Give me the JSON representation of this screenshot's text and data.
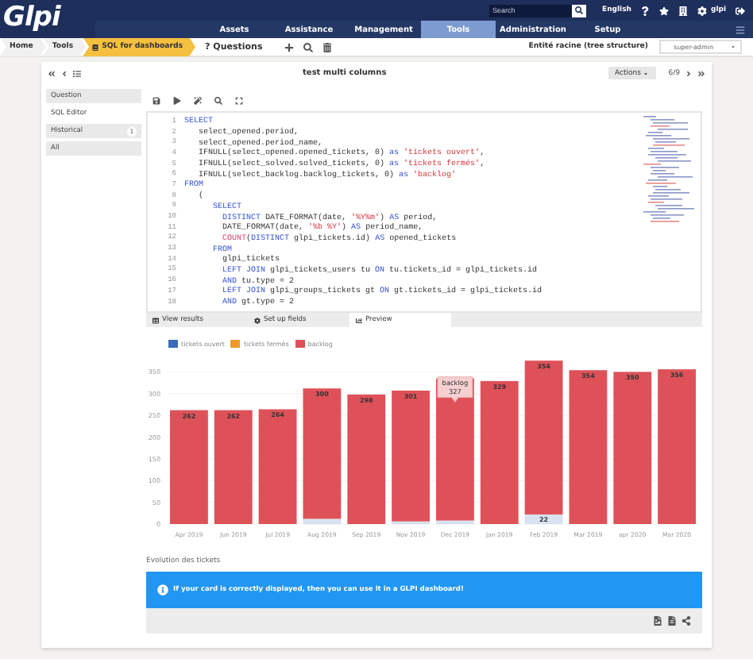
{
  "header": {
    "logo": "Glpi",
    "search": {
      "placeholder": "Search"
    },
    "language": "English",
    "user": "glpi"
  },
  "menu": [
    {
      "label": "Assets",
      "selected": false
    },
    {
      "label": "Assistance",
      "selected": false
    },
    {
      "label": "Management",
      "selected": false
    },
    {
      "label": "Tools",
      "selected": true
    },
    {
      "label": "Administration",
      "selected": false
    },
    {
      "label": "Setup",
      "selected": false
    }
  ],
  "breadcrumb": [
    {
      "label": "Home",
      "kind": "crumb"
    },
    {
      "label": "Tools",
      "kind": "crumb"
    },
    {
      "label": "SQL for dashboards",
      "kind": "current"
    }
  ],
  "questions_link": "? Questions",
  "entity": "Entité racine (tree structure)",
  "profile": "super-admin",
  "card": {
    "title": "test multi columns",
    "actions": "Actions",
    "pager": "6/9"
  },
  "nav": [
    {
      "label": "Question",
      "selected": false
    },
    {
      "label": "SQL Editor",
      "selected": true
    },
    {
      "label": "Historical",
      "selected": false,
      "badge": "1"
    },
    {
      "label": "All",
      "selected": false
    }
  ],
  "code_lines": [
    {
      "number": "1",
      "tokens": [
        {
          "text": "SELECT",
          "kind": "keyword"
        }
      ]
    },
    {
      "number": "2",
      "tokens": [
        {
          "text": "   select_opened.period,",
          "kind": "plain"
        }
      ]
    },
    {
      "number": "3",
      "tokens": [
        {
          "text": "   select_opened.period_name,",
          "kind": "plain"
        }
      ]
    },
    {
      "number": "4",
      "tokens": [
        {
          "text": "   IFNULL(select_opened.opened_tickets, 0) ",
          "kind": "plain"
        },
        {
          "text": "as",
          "kind": "keyword"
        },
        {
          "text": " 'tickets ouvert'",
          "kind": "string"
        },
        {
          "text": ",",
          "kind": "plain"
        }
      ]
    },
    {
      "number": "5",
      "tokens": [
        {
          "text": "   IFNULL(select_solved.solved_tickets, 0) ",
          "kind": "plain"
        },
        {
          "text": "as",
          "kind": "keyword"
        },
        {
          "text": " 'tickets fermés'",
          "kind": "string"
        },
        {
          "text": ",",
          "kind": "plain"
        }
      ]
    },
    {
      "number": "6",
      "tokens": [
        {
          "text": "   IFNULL(select_backlog.backlog_tickets, 0) ",
          "kind": "plain"
        },
        {
          "text": "as",
          "kind": "keyword"
        },
        {
          "text": " 'backlog'",
          "kind": "string"
        }
      ]
    },
    {
      "number": "7",
      "tokens": [
        {
          "text": "FROM",
          "kind": "keyword"
        }
      ]
    },
    {
      "number": "8",
      "tokens": [
        {
          "text": "   (",
          "kind": "plain"
        }
      ]
    },
    {
      "number": "9",
      "tokens": [
        {
          "text": "      SELECT",
          "kind": "keyword"
        }
      ]
    },
    {
      "number": "10",
      "tokens": [
        {
          "text": "        DISTINCT",
          "kind": "keyword"
        },
        {
          "text": " DATE_FORMAT(date, ",
          "kind": "plain"
        },
        {
          "text": "'%Y%m'",
          "kind": "string"
        },
        {
          "text": ") ",
          "kind": "plain"
        },
        {
          "text": "AS",
          "kind": "keyword"
        },
        {
          "text": " period,",
          "kind": "plain"
        }
      ]
    },
    {
      "number": "11",
      "tokens": [
        {
          "text": "        DATE_FORMAT(date, ",
          "kind": "plain"
        },
        {
          "text": "'%b %Y'",
          "kind": "string"
        },
        {
          "text": ") ",
          "kind": "plain"
        },
        {
          "text": "AS",
          "kind": "keyword"
        },
        {
          "text": " period_name,",
          "kind": "plain"
        }
      ]
    },
    {
      "number": "12",
      "tokens": [
        {
          "text": "        COUNT",
          "kind": "function"
        },
        {
          "text": "(",
          "kind": "plain"
        },
        {
          "text": "DISTINCT",
          "kind": "keyword"
        },
        {
          "text": " glpi_tickets.id) ",
          "kind": "plain"
        },
        {
          "text": "AS",
          "kind": "keyword"
        },
        {
          "text": " opened_tickets",
          "kind": "plain"
        }
      ]
    },
    {
      "number": "13",
      "tokens": [
        {
          "text": "      FROM",
          "kind": "keyword"
        }
      ]
    },
    {
      "number": "14",
      "tokens": [
        {
          "text": "        glpi_tickets",
          "kind": "plain"
        }
      ]
    },
    {
      "number": "15",
      "tokens": [
        {
          "text": "        LEFT JOIN",
          "kind": "keyword"
        },
        {
          "text": " glpi_tickets_users tu ",
          "kind": "plain"
        },
        {
          "text": "ON",
          "kind": "keyword"
        },
        {
          "text": " tu.tickets_id = glpi_tickets.id",
          "kind": "plain"
        }
      ]
    },
    {
      "number": "16",
      "tokens": [
        {
          "text": "        AND",
          "kind": "keyword"
        },
        {
          "text": " tu.type = 2",
          "kind": "plain"
        }
      ]
    },
    {
      "number": "17",
      "tokens": [
        {
          "text": "        LEFT JOIN",
          "kind": "keyword"
        },
        {
          "text": " glpi_groups_tickets gt ",
          "kind": "plain"
        },
        {
          "text": "ON",
          "kind": "keyword"
        },
        {
          "text": " gt.tickets_id = glpi_tickets.id",
          "kind": "plain"
        }
      ]
    },
    {
      "number": "18",
      "tokens": [
        {
          "text": "        AND",
          "kind": "keyword"
        },
        {
          "text": " gt.type = 2",
          "kind": "plain"
        }
      ]
    }
  ],
  "result_tabs": [
    {
      "label": "View results",
      "selected": false
    },
    {
      "label": "Set up fields",
      "selected": false
    },
    {
      "label": "Preview",
      "selected": true
    }
  ],
  "chart_data": {
    "type": "bar",
    "stacked": true,
    "grid": true,
    "categories": [
      "Apr 2019",
      "Jun 2019",
      "Jul 2019",
      "Aug 2019",
      "Sep 2019",
      "Nov 2019",
      "Dec 2019",
      "Jan 2019",
      "Feb 2019",
      "Mar 2019",
      "apr 2020",
      "Mar 2020"
    ],
    "series": [
      {
        "name": "tickets ouvert",
        "color": "#3a6db5",
        "values": [
          0,
          0,
          0,
          12,
          0,
          6,
          8,
          0,
          22,
          0,
          0,
          0
        ]
      },
      {
        "name": "tickets fermés",
        "color": "#ee9a2a",
        "values": [
          0,
          0,
          0,
          0,
          0,
          0,
          0,
          0,
          0,
          0,
          0,
          0
        ]
      },
      {
        "name": "backlog",
        "color": "#df5158",
        "values": [
          262,
          262,
          264,
          300,
          298,
          301,
          327,
          329,
          354,
          354,
          350,
          356
        ]
      }
    ],
    "value_labels": [
      [
        null,
        null,
        null,
        null,
        null,
        null,
        null,
        null,
        "22",
        null,
        null,
        null
      ],
      [
        null,
        null,
        null,
        null,
        null,
        null,
        null,
        null,
        null,
        null,
        null,
        null
      ],
      [
        "262",
        "262",
        "264",
        "300",
        "298",
        "301",
        null,
        "329",
        "354",
        "354",
        "350",
        "356"
      ]
    ],
    "ylim": [
      0,
      380
    ],
    "yticks": [
      0,
      50,
      100,
      150,
      200,
      250,
      300,
      350
    ]
  },
  "chart_tooltip": {
    "title": "backlog",
    "value": "327",
    "hovered": [
      false,
      false,
      false,
      false,
      false,
      false,
      true,
      false,
      false,
      false,
      false,
      false
    ]
  },
  "card_title": "Evolution des tickets",
  "notice": "If your card is correctly displayed, then you can use it in a GLPI dashboard!"
}
